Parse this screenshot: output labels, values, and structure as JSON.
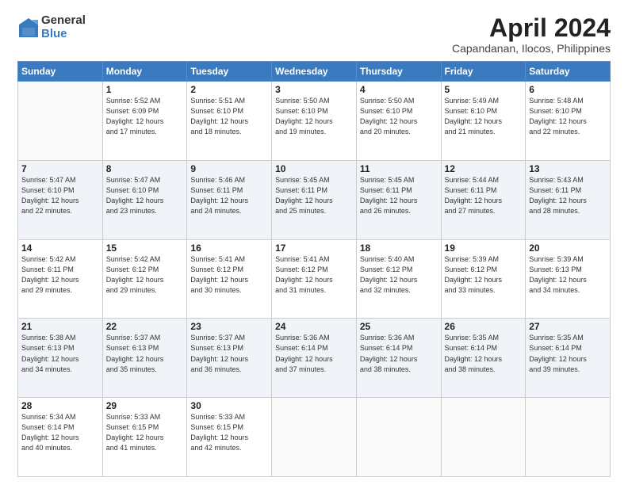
{
  "logo": {
    "general": "General",
    "blue": "Blue"
  },
  "title": "April 2024",
  "location": "Capandanan, Ilocos, Philippines",
  "weekdays": [
    "Sunday",
    "Monday",
    "Tuesday",
    "Wednesday",
    "Thursday",
    "Friday",
    "Saturday"
  ],
  "weeks": [
    [
      {
        "day": "",
        "info": ""
      },
      {
        "day": "1",
        "info": "Sunrise: 5:52 AM\nSunset: 6:09 PM\nDaylight: 12 hours\nand 17 minutes."
      },
      {
        "day": "2",
        "info": "Sunrise: 5:51 AM\nSunset: 6:10 PM\nDaylight: 12 hours\nand 18 minutes."
      },
      {
        "day": "3",
        "info": "Sunrise: 5:50 AM\nSunset: 6:10 PM\nDaylight: 12 hours\nand 19 minutes."
      },
      {
        "day": "4",
        "info": "Sunrise: 5:50 AM\nSunset: 6:10 PM\nDaylight: 12 hours\nand 20 minutes."
      },
      {
        "day": "5",
        "info": "Sunrise: 5:49 AM\nSunset: 6:10 PM\nDaylight: 12 hours\nand 21 minutes."
      },
      {
        "day": "6",
        "info": "Sunrise: 5:48 AM\nSunset: 6:10 PM\nDaylight: 12 hours\nand 22 minutes."
      }
    ],
    [
      {
        "day": "7",
        "info": "Sunrise: 5:47 AM\nSunset: 6:10 PM\nDaylight: 12 hours\nand 22 minutes."
      },
      {
        "day": "8",
        "info": "Sunrise: 5:47 AM\nSunset: 6:10 PM\nDaylight: 12 hours\nand 23 minutes."
      },
      {
        "day": "9",
        "info": "Sunrise: 5:46 AM\nSunset: 6:11 PM\nDaylight: 12 hours\nand 24 minutes."
      },
      {
        "day": "10",
        "info": "Sunrise: 5:45 AM\nSunset: 6:11 PM\nDaylight: 12 hours\nand 25 minutes."
      },
      {
        "day": "11",
        "info": "Sunrise: 5:45 AM\nSunset: 6:11 PM\nDaylight: 12 hours\nand 26 minutes."
      },
      {
        "day": "12",
        "info": "Sunrise: 5:44 AM\nSunset: 6:11 PM\nDaylight: 12 hours\nand 27 minutes."
      },
      {
        "day": "13",
        "info": "Sunrise: 5:43 AM\nSunset: 6:11 PM\nDaylight: 12 hours\nand 28 minutes."
      }
    ],
    [
      {
        "day": "14",
        "info": "Sunrise: 5:42 AM\nSunset: 6:11 PM\nDaylight: 12 hours\nand 29 minutes."
      },
      {
        "day": "15",
        "info": "Sunrise: 5:42 AM\nSunset: 6:12 PM\nDaylight: 12 hours\nand 29 minutes."
      },
      {
        "day": "16",
        "info": "Sunrise: 5:41 AM\nSunset: 6:12 PM\nDaylight: 12 hours\nand 30 minutes."
      },
      {
        "day": "17",
        "info": "Sunrise: 5:41 AM\nSunset: 6:12 PM\nDaylight: 12 hours\nand 31 minutes."
      },
      {
        "day": "18",
        "info": "Sunrise: 5:40 AM\nSunset: 6:12 PM\nDaylight: 12 hours\nand 32 minutes."
      },
      {
        "day": "19",
        "info": "Sunrise: 5:39 AM\nSunset: 6:12 PM\nDaylight: 12 hours\nand 33 minutes."
      },
      {
        "day": "20",
        "info": "Sunrise: 5:39 AM\nSunset: 6:13 PM\nDaylight: 12 hours\nand 34 minutes."
      }
    ],
    [
      {
        "day": "21",
        "info": "Sunrise: 5:38 AM\nSunset: 6:13 PM\nDaylight: 12 hours\nand 34 minutes."
      },
      {
        "day": "22",
        "info": "Sunrise: 5:37 AM\nSunset: 6:13 PM\nDaylight: 12 hours\nand 35 minutes."
      },
      {
        "day": "23",
        "info": "Sunrise: 5:37 AM\nSunset: 6:13 PM\nDaylight: 12 hours\nand 36 minutes."
      },
      {
        "day": "24",
        "info": "Sunrise: 5:36 AM\nSunset: 6:14 PM\nDaylight: 12 hours\nand 37 minutes."
      },
      {
        "day": "25",
        "info": "Sunrise: 5:36 AM\nSunset: 6:14 PM\nDaylight: 12 hours\nand 38 minutes."
      },
      {
        "day": "26",
        "info": "Sunrise: 5:35 AM\nSunset: 6:14 PM\nDaylight: 12 hours\nand 38 minutes."
      },
      {
        "day": "27",
        "info": "Sunrise: 5:35 AM\nSunset: 6:14 PM\nDaylight: 12 hours\nand 39 minutes."
      }
    ],
    [
      {
        "day": "28",
        "info": "Sunrise: 5:34 AM\nSunset: 6:14 PM\nDaylight: 12 hours\nand 40 minutes."
      },
      {
        "day": "29",
        "info": "Sunrise: 5:33 AM\nSunset: 6:15 PM\nDaylight: 12 hours\nand 41 minutes."
      },
      {
        "day": "30",
        "info": "Sunrise: 5:33 AM\nSunset: 6:15 PM\nDaylight: 12 hours\nand 42 minutes."
      },
      {
        "day": "",
        "info": ""
      },
      {
        "day": "",
        "info": ""
      },
      {
        "day": "",
        "info": ""
      },
      {
        "day": "",
        "info": ""
      }
    ]
  ]
}
